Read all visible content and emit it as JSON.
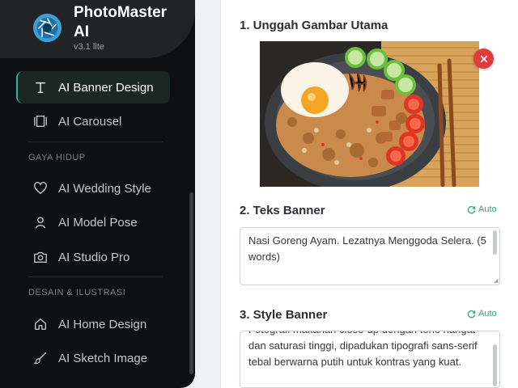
{
  "brand": {
    "name": "PhotoMaster AI",
    "version": "v3.1 lite"
  },
  "sidebar": {
    "items_top": [
      {
        "label": "AI Banner Design",
        "icon": "text-icon",
        "active": true
      },
      {
        "label": "AI Carousel",
        "icon": "carousel-icon",
        "active": false
      }
    ],
    "section_gaya": "GAYA HIDUP",
    "items_gaya": [
      {
        "label": "AI Wedding Style",
        "icon": "heart-icon"
      },
      {
        "label": "AI Model Pose",
        "icon": "user-icon"
      },
      {
        "label": "AI Studio Pro",
        "icon": "camera-icon"
      }
    ],
    "section_desain": "DESAIN & ILUSTRASI",
    "items_desain": [
      {
        "label": "AI Home Design",
        "icon": "home-icon"
      },
      {
        "label": "AI Sketch Image",
        "icon": "brush-icon"
      }
    ]
  },
  "main": {
    "upload_heading": "1. Unggah Gambar Utama",
    "text_heading": "2. Teks Banner",
    "text_auto": "Auto",
    "text_value": "Nasi Goreng Ayam. Lezatnya Menggoda Selera. (5 words)",
    "style_heading": "3. Style Banner",
    "style_auto": "Auto",
    "style_value": "Fotografi makanan close-up dengan tone hangat dan saturasi tinggi, dipadukan tipografi sans-serif tebal berwarna putih untuk kontras yang kuat."
  },
  "colors": {
    "accent": "#2fb88f",
    "danger": "#e23b3b",
    "sidebar_bg": "#0f1011"
  }
}
